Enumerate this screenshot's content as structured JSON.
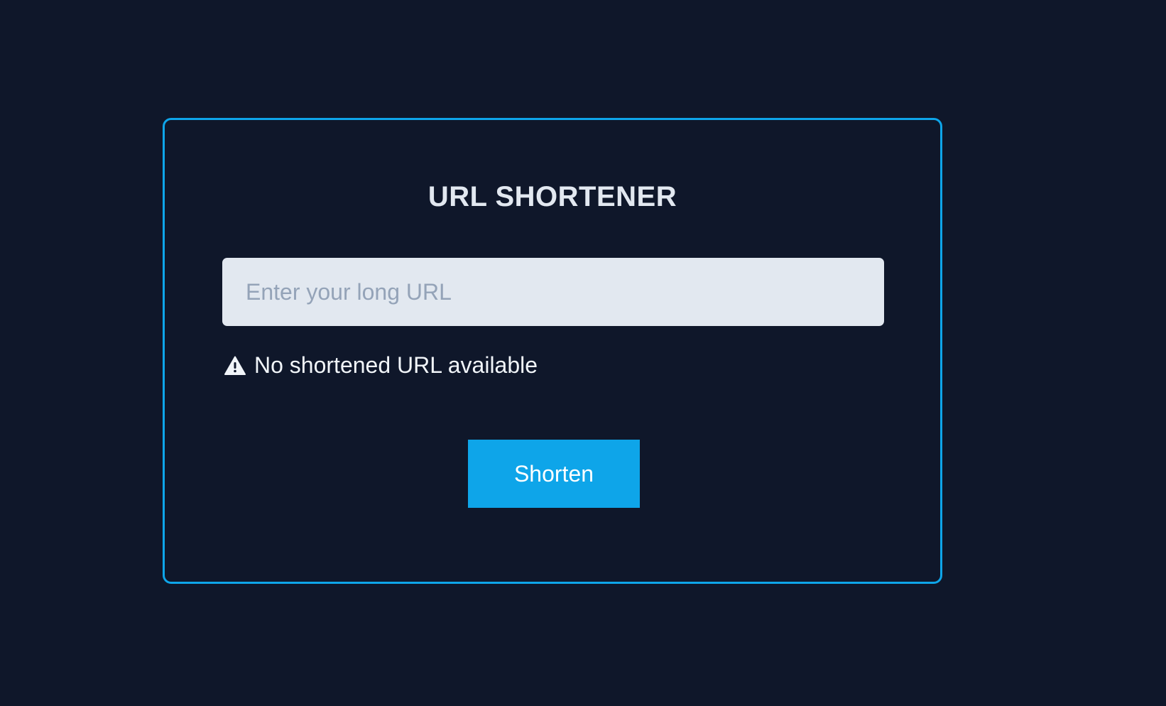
{
  "card": {
    "title": "URL SHORTENER",
    "input": {
      "value": "",
      "placeholder": "Enter your long URL"
    },
    "status": {
      "icon": "warning-icon",
      "text": "No shortened URL available"
    },
    "button": {
      "label": "Shorten"
    }
  },
  "colors": {
    "background": "#0f172a",
    "accent": "#0ea5e9",
    "input_background": "#e2e8f0",
    "title_text": "#e2e8f0"
  }
}
